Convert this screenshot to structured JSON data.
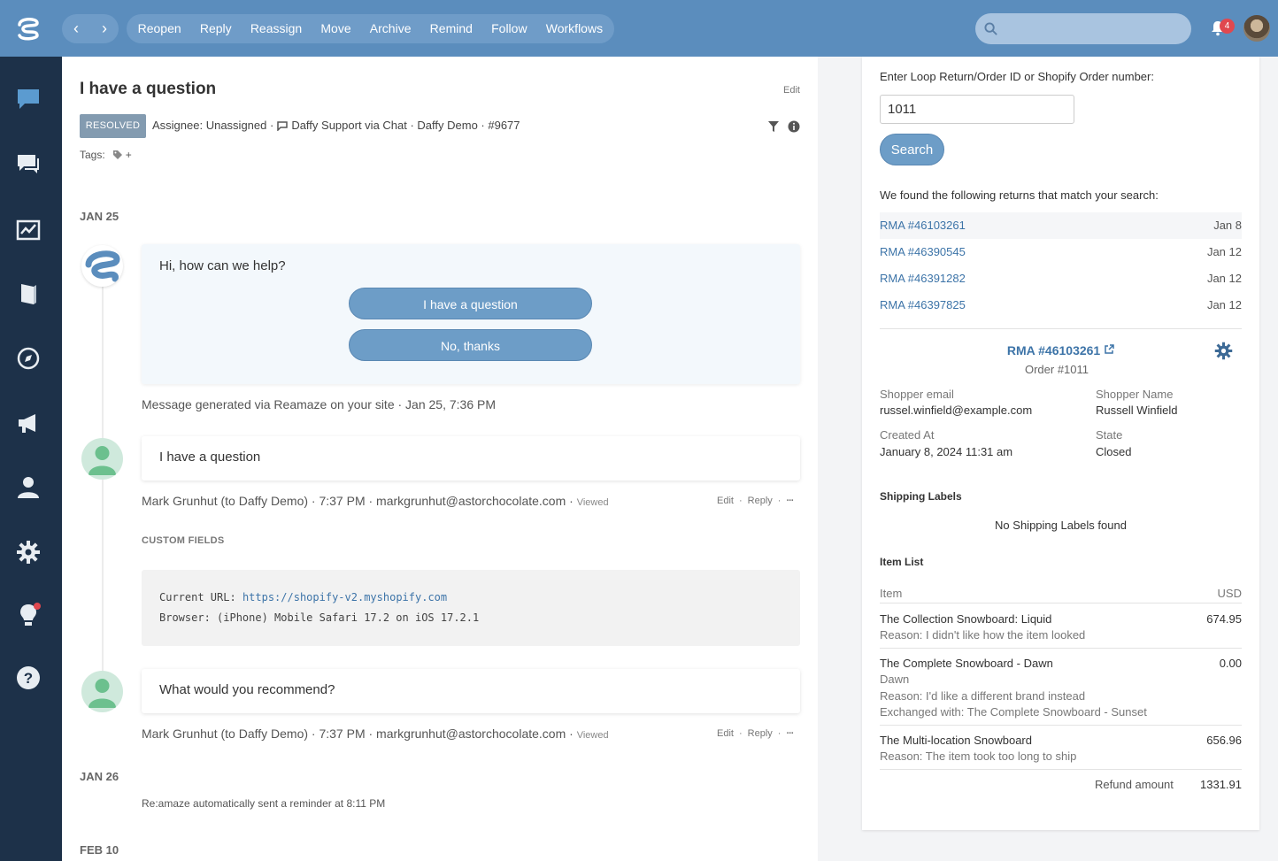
{
  "topbar": {
    "actions": [
      "Reopen",
      "Reply",
      "Reassign",
      "Move",
      "Archive",
      "Remind",
      "Follow",
      "Workflows"
    ],
    "notification_count": "4"
  },
  "sidebar": {
    "items": [
      "chat-bubble-icon",
      "conversations-icon",
      "reports-icon",
      "book-icon",
      "compass-icon",
      "megaphone-icon",
      "person-icon",
      "gear-icon",
      "lightbulb-icon",
      "help-icon"
    ]
  },
  "conversation": {
    "title": "I have a question",
    "edit_label": "Edit",
    "status": "RESOLVED",
    "assignee": "Assignee: Unassigned ·",
    "channel": "Daffy Support via Chat · Daffy Demo · #9677",
    "tags_label": "Tags:",
    "tags_add": "+",
    "date1": "JAN 25",
    "bot_message": "Hi, how can we help?",
    "choice1": "I have a question",
    "choice2": "No, thanks",
    "generated_note": "Message generated via Reamaze on your site · Jan 25, 7:36 PM",
    "msg1_text": "I have a question",
    "msg1_meta": "Mark Grunhut (to Daffy Demo) · 7:37 PM · markgrunhut@astorchocolate.com ·",
    "viewed": "Viewed",
    "action_edit": "Edit",
    "action_reply": "Reply",
    "dot": "·",
    "more": "···",
    "custom_fields_title": "CUSTOM FIELDS",
    "current_url_label": "Current URL:",
    "current_url": "https://shopify-v2.myshopify.com",
    "browser_line": "Browser: (iPhone) Mobile Safari 17.2 on iOS 17.2.1",
    "msg2_text": "What would you recommend?",
    "msg2_meta": "Mark Grunhut (to Daffy Demo) · 7:37 PM · markgrunhut@astorchocolate.com ·",
    "date2": "JAN 26",
    "reminder": "Re:amaze automatically sent a reminder at 8:11 PM",
    "date3": "FEB 10"
  },
  "panel": {
    "prompt": "Enter Loop Return/Order ID or Shopify Order number:",
    "order_input": "1011",
    "search_button": "Search",
    "found_text": "We found the following returns that match your search:",
    "rmas": [
      {
        "label": "RMA #46103261",
        "date": "Jan 8"
      },
      {
        "label": "RMA #46390545",
        "date": "Jan 12"
      },
      {
        "label": "RMA #46391282",
        "date": "Jan 12"
      },
      {
        "label": "RMA #46397825",
        "date": "Jan 12"
      }
    ],
    "selected_rma": "RMA #46103261",
    "order_sub": "Order #1011",
    "shopper_email_label": "Shopper email",
    "shopper_email": "russel.winfield@example.com",
    "shopper_name_label": "Shopper Name",
    "shopper_name": "Russell Winfield",
    "created_label": "Created At",
    "created_value": "January 8, 2024 11:31 am",
    "state_label": "State",
    "state_value": "Closed",
    "shipping_title": "Shipping Labels",
    "no_shipping": "No Shipping Labels found",
    "item_list_title": "Item List",
    "item_col": "Item",
    "usd_col": "USD",
    "items": [
      {
        "name": "The Collection Snowboard: Liquid",
        "price": "674.95",
        "sub1": "Reason: I didn't like how the item looked"
      },
      {
        "name": "The Complete Snowboard - Dawn",
        "price": "0.00",
        "sub1": "Dawn",
        "sub2": "Reason: I'd like a different brand instead",
        "sub3": "Exchanged with: The Complete Snowboard - Sunset"
      },
      {
        "name": "The Multi-location Snowboard",
        "price": "656.96",
        "sub1": "Reason: The item took too long to ship"
      }
    ],
    "refund_label": "Refund amount",
    "refund_value": "1331.91"
  },
  "colors": {
    "topbar": "#5b8dbd",
    "sidebar": "#1d3149",
    "link": "#3d74a8",
    "button": "#6d9dc7"
  }
}
